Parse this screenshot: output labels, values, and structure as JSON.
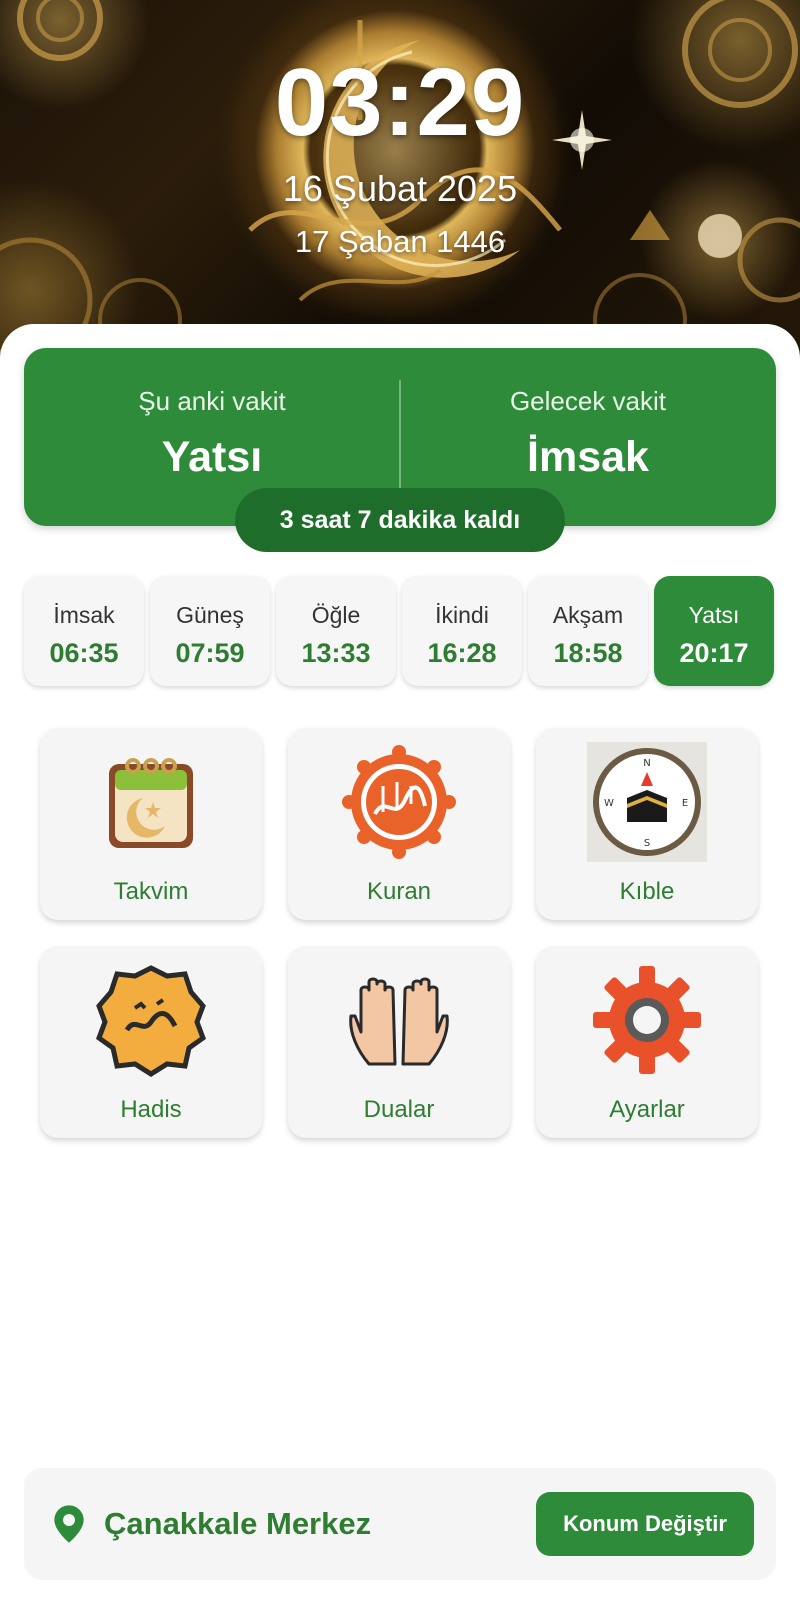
{
  "header": {
    "clock": "03:29",
    "date_gregorian": "16 Şubat 2025",
    "date_hijri": "17 Şaban 1446",
    "background_image": "golden-islamic-crescent-ornament"
  },
  "prayer_status": {
    "current_label": "Şu anki vakit",
    "current_value": "Yatsı",
    "next_label": "Gelecek vakit",
    "next_value": "İmsak",
    "remaining": "3 saat 7 dakika kaldı"
  },
  "prayer_times": [
    {
      "name": "İmsak",
      "time": "06:35",
      "active": false
    },
    {
      "name": "Güneş",
      "time": "07:59",
      "active": false
    },
    {
      "name": "Öğle",
      "time": "13:33",
      "active": false
    },
    {
      "name": "İkindi",
      "time": "16:28",
      "active": false
    },
    {
      "name": "Akşam",
      "time": "18:58",
      "active": false
    },
    {
      "name": "Yatsı",
      "time": "20:17",
      "active": true
    }
  ],
  "features": [
    {
      "label": "Takvim",
      "icon": "calendar-crescent-icon"
    },
    {
      "label": "Kuran",
      "icon": "quran-emblem-icon"
    },
    {
      "label": "Kıble",
      "icon": "qibla-compass-icon"
    },
    {
      "label": "Hadis",
      "icon": "hadith-seal-icon"
    },
    {
      "label": "Dualar",
      "icon": "praying-hands-icon"
    },
    {
      "label": "Ayarlar",
      "icon": "gear-icon"
    }
  ],
  "location": {
    "icon": "location-pin-icon",
    "name": "Çanakkale Merkez",
    "button_label": "Konum Değiştir"
  },
  "colors": {
    "primary_green": "#2e8b3a",
    "dark_green": "#1f6d2a",
    "text_green": "#2e7d32",
    "card_bg": "#f5f5f5",
    "accent_orange": "#e8622a",
    "gold": "#d9a94a"
  }
}
